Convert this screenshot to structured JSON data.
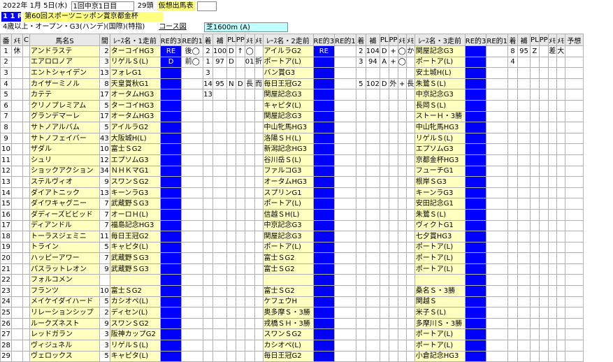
{
  "header": {
    "date": "2022年 1月 5日(水)",
    "meet": "1回中京1日目",
    "heads": "29頭",
    "status": "仮想出馬表",
    "race_no": "1 1 R",
    "race_name": "第60回スポーツニッポン賞京都金杯",
    "conditions": "4歳以上・オープン・G3(ハンデ)(国際)(特指)",
    "course_label": "コース図",
    "course": "芝1600m (A)"
  },
  "columns": [
    "番",
    "ﾒﾓ",
    "C",
    "馬名S",
    "間",
    "ﾚｰｽ名・1走前",
    "RE的3",
    "RE的1",
    "着",
    "補",
    "PL",
    "PP",
    "ﾒﾓ",
    "ﾒﾓ",
    "ﾚｰｽ名・2走前",
    "RE的3",
    "RE的1",
    "着",
    "補",
    "PL",
    "PP",
    "ﾒﾓ",
    "ﾒﾓ",
    "ﾚｰｽ名・3走前",
    "RE的3",
    "RE的1",
    "着",
    "補",
    "PL",
    "PP",
    "ﾒﾓ",
    "ﾒﾓ",
    "予想"
  ],
  "rows": [
    {
      "no": "1",
      "memo": "休",
      "c": "",
      "name": "アンドラステ",
      "gap": "2",
      "r1": "ターコイHG3",
      "r1a": "RE",
      "r1b": "後◯",
      "r1p": "2",
      "r1h": "100",
      "r1pl": "D",
      "r1pp": "↑",
      "r1m": "◯",
      "r1m2": "",
      "r2": "アイルラG2",
      "r2a": "RE",
      "r2b": "",
      "r2p": "2",
      "r2h": "104",
      "r2pl": "D",
      "r2pp": "+",
      "r2m": "◯",
      "r2m2": "か",
      "r3": "関屋記念G3",
      "r3a": "",
      "r3b": "",
      "r3p": "8",
      "r3h": "95",
      "r3pl": "Z",
      "r3pp": "",
      "r3m": "差",
      "r3m2": "大"
    },
    {
      "no": "2",
      "memo": "",
      "c": "",
      "name": "エアロロノア",
      "gap": "3",
      "r1": "リゲルＳ(L)",
      "r1a": "D",
      "r1b": "前◯",
      "r1p": "1",
      "r1h": "97",
      "r1pl": "D",
      "r1pp": "",
      "r1m": "01",
      "r1m2": "折",
      "r2": "ポートア(L)",
      "r2a": "",
      "r2b": "",
      "r2p": "3",
      "r2h": "94",
      "r2pl": "A",
      "r2pp": "+",
      "r2m": "◯",
      "r2m2": "",
      "r3": "ポートア(L)",
      "r3a": "",
      "r3b": "",
      "r3p": "4",
      "r3h": "",
      "r3pl": "",
      "r3pp": "",
      "r3m": "",
      "r3m2": ""
    },
    {
      "no": "3",
      "memo": "",
      "c": "",
      "name": "エントシャイデン",
      "gap": "13",
      "r1": "フォレG1",
      "r1a": "",
      "r1b": "",
      "r1p": "3",
      "r1h": "",
      "r1pl": "",
      "r1pp": "",
      "r1m": "",
      "r1m2": "",
      "r2": "バン賞G3",
      "r2a": "",
      "r2b": "",
      "r2p": "",
      "r2h": "",
      "r2pl": "",
      "r2pp": "",
      "r2m": "",
      "r2m2": "",
      "r3": "安土城H(L)",
      "r3a": "",
      "r3b": "",
      "r3p": "",
      "r3h": "",
      "r3pl": "",
      "r3pp": "",
      "r3m": "",
      "r3m2": ""
    },
    {
      "no": "4",
      "memo": "",
      "c": "",
      "name": "カイザーミノル",
      "gap": "8",
      "r1": "天皇賞秋G1",
      "r1a": "",
      "r1b": "",
      "r1p": "14",
      "r1h": "95",
      "r1pl": "N",
      "r1pp": "D",
      "r1m": "長",
      "r1m2": "而",
      "r2": "毎日王冠G2",
      "r2a": "",
      "r2b": "",
      "r2p": "5",
      "r2h": "102",
      "r2pl": "D",
      "r2pp": "外",
      "r2m": "+",
      "r2m2": "長",
      "r3": "朱鷺Ｓ(L)",
      "r3a": "",
      "r3b": "",
      "r3p": "",
      "r3h": "",
      "r3pl": "",
      "r3pp": "",
      "r3m": "",
      "r3m2": ""
    },
    {
      "no": "5",
      "memo": "",
      "c": "",
      "name": "カテテ",
      "gap": "17",
      "r1": "オータムHG3",
      "r1a": "",
      "r1b": "",
      "r1p": "13",
      "r1h": "",
      "r1pl": "",
      "r1pp": "",
      "r1m": "",
      "r1m2": "",
      "r2": "関屋記念G3",
      "r2a": "",
      "r2b": "",
      "r2p": "",
      "r2h": "",
      "r2pl": "",
      "r2pp": "",
      "r2m": "",
      "r2m2": "",
      "r3": "中京記念G3",
      "r3a": "",
      "r3b": "",
      "r3p": "",
      "r3h": "",
      "r3pl": "",
      "r3pp": "",
      "r3m": "",
      "r3m2": ""
    },
    {
      "no": "6",
      "memo": "",
      "c": "",
      "name": "クリノプレミアム",
      "gap": "5",
      "r1": "ターコイHG3",
      "r1a": "",
      "r1b": "",
      "r1p": "",
      "r1h": "",
      "r1pl": "",
      "r1pp": "",
      "r1m": "",
      "r1m2": "",
      "r2": "キャピタ(L)",
      "r2a": "",
      "r2b": "",
      "r2p": "",
      "r2h": "",
      "r2pl": "",
      "r2pp": "",
      "r2m": "",
      "r2m2": "",
      "r3": "長岡Ｓ(L)",
      "r3a": "",
      "r3b": "",
      "r3p": "",
      "r3h": "",
      "r3pl": "",
      "r3pp": "",
      "r3m": "",
      "r3m2": ""
    },
    {
      "no": "7",
      "memo": "",
      "c": "",
      "name": "グランデマーレ",
      "gap": "17",
      "r1": "オータムHG3",
      "r1a": "",
      "r1b": "",
      "r1p": "",
      "r1h": "",
      "r1pl": "",
      "r1pp": "",
      "r1m": "",
      "r1m2": "",
      "r2": "関屋記念G3",
      "r2a": "",
      "r2b": "",
      "r2p": "",
      "r2h": "",
      "r2pl": "",
      "r2pp": "",
      "r2m": "",
      "r2m2": "",
      "r3": "ストーＨ・3勝",
      "r3a": "",
      "r3b": "",
      "r3p": "",
      "r3h": "",
      "r3pl": "",
      "r3pp": "",
      "r3m": "",
      "r3m2": ""
    },
    {
      "no": "8",
      "memo": "",
      "c": "",
      "name": "サトノアルバム",
      "gap": "5",
      "r1": "アイルラG2",
      "r1a": "",
      "r1b": "",
      "r1p": "",
      "r1h": "",
      "r1pl": "",
      "r1pp": "",
      "r1m": "",
      "r1m2": "",
      "r2": "中山牝馬HG3",
      "r2a": "",
      "r2b": "",
      "r2p": "",
      "r2h": "",
      "r2pl": "",
      "r2pp": "",
      "r2m": "",
      "r2m2": "",
      "r3": "中山牝馬HG3",
      "r3a": "",
      "r3b": "",
      "r3p": "",
      "r3h": "",
      "r3pl": "",
      "r3pp": "",
      "r3m": "",
      "r3m2": ""
    },
    {
      "no": "9",
      "memo": "",
      "c": "",
      "name": "サトノフェイバー",
      "gap": "43",
      "r1": "大阪城H(L)",
      "r1a": "",
      "r1b": "",
      "r1p": "",
      "r1h": "",
      "r1pl": "",
      "r1pp": "",
      "r1m": "",
      "r1m2": "",
      "r2": "洛陽ＳＨ(L)",
      "r2a": "",
      "r2b": "",
      "r2p": "",
      "r2h": "",
      "r2pl": "",
      "r2pp": "",
      "r2m": "",
      "r2m2": "",
      "r3": "リゲルＳ(L)",
      "r3a": "",
      "r3b": "",
      "r3p": "",
      "r3h": "",
      "r3pl": "",
      "r3pp": "",
      "r3m": "",
      "r3m2": ""
    },
    {
      "no": "10",
      "memo": "",
      "c": "",
      "name": "ザダル",
      "gap": "10",
      "r1": "富士ＳG2",
      "r1a": "",
      "r1b": "",
      "r1p": "",
      "r1h": "",
      "r1pl": "",
      "r1pp": "",
      "r1m": "",
      "r1m2": "",
      "r2": "新潟記念HG3",
      "r2a": "",
      "r2b": "",
      "r2p": "",
      "r2h": "",
      "r2pl": "",
      "r2pp": "",
      "r2m": "",
      "r2m2": "",
      "r3": "エプソムG3",
      "r3a": "",
      "r3b": "",
      "r3p": "",
      "r3h": "",
      "r3pl": "",
      "r3pp": "",
      "r3m": "",
      "r3m2": ""
    },
    {
      "no": "11",
      "memo": "",
      "c": "",
      "name": "シュリ",
      "gap": "12",
      "r1": "エプソムG3",
      "r1a": "",
      "r1b": "",
      "r1p": "",
      "r1h": "",
      "r1pl": "",
      "r1pp": "",
      "r1m": "",
      "r1m2": "",
      "r2": "谷川岳Ｓ(L)",
      "r2a": "",
      "r2b": "",
      "r2p": "",
      "r2h": "",
      "r2pl": "",
      "r2pp": "",
      "r2m": "",
      "r2m2": "",
      "r3": "京都金杯HG3",
      "r3a": "",
      "r3b": "",
      "r3p": "",
      "r3h": "",
      "r3pl": "",
      "r3pp": "",
      "r3m": "",
      "r3m2": ""
    },
    {
      "no": "12",
      "memo": "",
      "c": "",
      "name": "ショックアクション",
      "gap": "34",
      "r1": "ＮＨＫマG1",
      "r1a": "",
      "r1b": "",
      "r1p": "",
      "r1h": "",
      "r1pl": "",
      "r1pp": "",
      "r1m": "",
      "r1m2": "",
      "r2": "ファルコG3",
      "r2a": "",
      "r2b": "",
      "r2p": "",
      "r2h": "",
      "r2pl": "",
      "r2pp": "",
      "r2m": "",
      "r2m2": "",
      "r3": "フューチG1",
      "r3a": "",
      "r3b": "",
      "r3p": "",
      "r3h": "",
      "r3pl": "",
      "r3pp": "",
      "r3m": "",
      "r3m2": ""
    },
    {
      "no": "13",
      "memo": "",
      "c": "",
      "name": "ステルヴィオ",
      "gap": "9",
      "r1": "スワンＳG2",
      "r1a": "",
      "r1b": "",
      "r1p": "",
      "r1h": "",
      "r1pl": "",
      "r1pp": "",
      "r1m": "",
      "r1m2": "",
      "r2": "オータムHG3",
      "r2a": "",
      "r2b": "",
      "r2p": "",
      "r2h": "",
      "r2pl": "",
      "r2pp": "",
      "r2m": "",
      "r2m2": "",
      "r3": "根岸ＳG3",
      "r3a": "",
      "r3b": "",
      "r3p": "",
      "r3h": "",
      "r3pl": "",
      "r3pp": "",
      "r3m": "",
      "r3m2": ""
    },
    {
      "no": "14",
      "memo": "",
      "c": "",
      "name": "ダイアトニック",
      "gap": "13",
      "r1": "キーンラG3",
      "r1a": "",
      "r1b": "",
      "r1p": "",
      "r1h": "",
      "r1pl": "",
      "r1pp": "",
      "r1m": "",
      "r1m2": "",
      "r2": "スプリンG1",
      "r2a": "",
      "r2b": "",
      "r2p": "",
      "r2h": "",
      "r2pl": "",
      "r2pp": "",
      "r2m": "",
      "r2m2": "",
      "r3": "キーンラG3",
      "r3a": "",
      "r3b": "",
      "r3p": "",
      "r3h": "",
      "r3pl": "",
      "r3pp": "",
      "r3m": "",
      "r3m2": ""
    },
    {
      "no": "15",
      "memo": "",
      "c": "",
      "name": "ダイワキャグニー",
      "gap": "7",
      "r1": "武蔵野ＳG3",
      "r1a": "",
      "r1b": "",
      "r1p": "",
      "r1h": "",
      "r1pl": "",
      "r1pp": "",
      "r1m": "",
      "r1m2": "",
      "r2": "ポートア(L)",
      "r2a": "",
      "r2b": "",
      "r2p": "",
      "r2h": "",
      "r2pl": "",
      "r2pp": "",
      "r2m": "",
      "r2m2": "",
      "r3": "安田記念G1",
      "r3a": "",
      "r3b": "",
      "r3p": "",
      "r3h": "",
      "r3pl": "",
      "r3pp": "",
      "r3m": "",
      "r3m2": ""
    },
    {
      "no": "16",
      "memo": "",
      "c": "",
      "name": "ダディーズビビッド",
      "gap": "7",
      "r1": "オーロＨ(L)",
      "r1a": "",
      "r1b": "",
      "r1p": "",
      "r1h": "",
      "r1pl": "",
      "r1pp": "",
      "r1m": "",
      "r1m2": "",
      "r2": "信越ＳH(L)",
      "r2a": "",
      "r2b": "",
      "r2p": "",
      "r2h": "",
      "r2pl": "",
      "r2pp": "",
      "r2m": "",
      "r2m2": "",
      "r3": "朱鷺Ｓ(L)",
      "r3a": "",
      "r3b": "",
      "r3p": "",
      "r3h": "",
      "r3pl": "",
      "r3pp": "",
      "r3m": "",
      "r3m2": ""
    },
    {
      "no": "17",
      "memo": "",
      "c": "",
      "name": "ディアンドル",
      "gap": "7",
      "r1": "福島記念HG3",
      "r1a": "",
      "r1b": "",
      "r1p": "",
      "r1h": "",
      "r1pl": "",
      "r1pp": "",
      "r1m": "",
      "r1m2": "",
      "r2": "中京記念G3",
      "r2a": "",
      "r2b": "",
      "r2p": "",
      "r2h": "",
      "r2pl": "",
      "r2pp": "",
      "r2m": "",
      "r2m2": "",
      "r3": "ヴィクトG1",
      "r3a": "",
      "r3b": "",
      "r3p": "",
      "r3h": "",
      "r3pl": "",
      "r3pp": "",
      "r3m": "",
      "r3m2": ""
    },
    {
      "no": "18",
      "memo": "",
      "c": "",
      "name": "トーラスジェミニ",
      "gap": "11",
      "r1": "毎日王冠G2",
      "r1a": "",
      "r1b": "",
      "r1p": "",
      "r1h": "",
      "r1pl": "",
      "r1pp": "",
      "r1m": "",
      "r1m2": "",
      "r2": "関屋記念G3",
      "r2a": "",
      "r2b": "",
      "r2p": "",
      "r2h": "",
      "r2pl": "",
      "r2pp": "",
      "r2m": "",
      "r2m2": "",
      "r3": "七夕賞HG3",
      "r3a": "",
      "r3b": "",
      "r3p": "",
      "r3h": "",
      "r3pl": "",
      "r3pp": "",
      "r3m": "",
      "r3m2": ""
    },
    {
      "no": "19",
      "memo": "",
      "c": "",
      "name": "トライン",
      "gap": "5",
      "r1": "キャピタ(L)",
      "r1a": "",
      "r1b": "",
      "r1p": "",
      "r1h": "",
      "r1pl": "",
      "r1pp": "",
      "r1m": "",
      "r1m2": "",
      "r2": "ポートア(L)",
      "r2a": "",
      "r2b": "",
      "r2p": "",
      "r2h": "",
      "r2pl": "",
      "r2pp": "",
      "r2m": "",
      "r2m2": "",
      "r3": "ポートア(L)",
      "r3a": "",
      "r3b": "",
      "r3p": "",
      "r3h": "",
      "r3pl": "",
      "r3pp": "",
      "r3m": "",
      "r3m2": ""
    },
    {
      "no": "20",
      "memo": "",
      "c": "",
      "name": "ハッピーアワー",
      "gap": "7",
      "r1": "武蔵野ＳG3",
      "r1a": "",
      "r1b": "",
      "r1p": "",
      "r1h": "",
      "r1pl": "",
      "r1pp": "",
      "r1m": "",
      "r1m2": "",
      "r2": "富士ＳG2",
      "r2a": "",
      "r2b": "",
      "r2p": "",
      "r2h": "",
      "r2pl": "",
      "r2pp": "",
      "r2m": "",
      "r2m2": "",
      "r3": "ポートア(L)",
      "r3a": "",
      "r3b": "",
      "r3p": "",
      "r3h": "",
      "r3pl": "",
      "r3pp": "",
      "r3m": "",
      "r3m2": ""
    },
    {
      "no": "21",
      "memo": "",
      "c": "",
      "name": "パスラットレオン",
      "gap": "9",
      "r1": "武蔵野ＳG3",
      "r1a": "",
      "r1b": "",
      "r1p": "",
      "r1h": "",
      "r1pl": "",
      "r1pp": "",
      "r1m": "",
      "r1m2": "",
      "r2": "富士ＳG2",
      "r2a": "",
      "r2b": "",
      "r2p": "",
      "r2h": "",
      "r2pl": "",
      "r2pp": "",
      "r2m": "",
      "r2m2": "",
      "r3": "ポートア(L)",
      "r3a": "",
      "r3b": "",
      "r3p": "",
      "r3h": "",
      "r3pl": "",
      "r3pp": "",
      "r3m": "",
      "r3m2": ""
    },
    {
      "no": "22",
      "memo": "",
      "c": "",
      "name": "フォルコメン",
      "gap": "",
      "r1": "",
      "r1a": "",
      "r1b": "",
      "r1p": "",
      "r1h": "",
      "r1pl": "",
      "r1pp": "",
      "r1m": "",
      "r1m2": "",
      "r2": "",
      "r2a": "",
      "r2b": "",
      "r2p": "",
      "r2h": "",
      "r2pl": "",
      "r2pp": "",
      "r2m": "",
      "r2m2": "",
      "r3": "",
      "r3a": "",
      "r3b": "",
      "r3p": "",
      "r3h": "",
      "r3pl": "",
      "r3pp": "",
      "r3m": "",
      "r3m2": ""
    },
    {
      "no": "23",
      "memo": "",
      "c": "",
      "name": "フランツ",
      "gap": "10",
      "r1": "富士ＳG2",
      "r1a": "",
      "r1b": "",
      "r1p": "",
      "r1h": "",
      "r1pl": "",
      "r1pp": "",
      "r1m": "",
      "r1m2": "",
      "r2": "富士ＳG2",
      "r2a": "",
      "r2b": "",
      "r2p": "",
      "r2h": "",
      "r2pl": "",
      "r2pp": "",
      "r2m": "",
      "r2m2": "",
      "r3": "桑名Ｓ・3勝",
      "r3a": "",
      "r3b": "",
      "r3p": "",
      "r3h": "",
      "r3pl": "",
      "r3pp": "",
      "r3m": "",
      "r3m2": ""
    },
    {
      "no": "24",
      "memo": "",
      "c": "",
      "name": "メイケイダイハード",
      "gap": "5",
      "r1": "カシオペ(L)",
      "r1a": "",
      "r1b": "",
      "r1p": "",
      "r1h": "",
      "r1pl": "",
      "r1pp": "",
      "r1m": "",
      "r1m2": "",
      "r2": "ケフェウH",
      "r2a": "",
      "r2b": "",
      "r2p": "",
      "r2h": "",
      "r2pl": "",
      "r2pp": "",
      "r2m": "",
      "r2m2": "",
      "r3": "関越Ｓ",
      "r3a": "",
      "r3b": "",
      "r3p": "",
      "r3h": "",
      "r3pl": "",
      "r3pp": "",
      "r3m": "",
      "r3m2": ""
    },
    {
      "no": "25",
      "memo": "",
      "c": "",
      "name": "リレーションシップ",
      "gap": "2",
      "r1": "ディセン(L)",
      "r1a": "",
      "r1b": "",
      "r1p": "",
      "r1h": "",
      "r1pl": "",
      "r1pp": "",
      "r1m": "",
      "r1m2": "",
      "r2": "奥多摩Ｓ・3勝",
      "r2a": "",
      "r2b": "",
      "r2p": "",
      "r2h": "",
      "r2pl": "",
      "r2pp": "",
      "r2m": "",
      "r2m2": "",
      "r3": "米子Ｓ(L)",
      "r3a": "",
      "r3b": "",
      "r3p": "",
      "r3h": "",
      "r3pl": "",
      "r3pp": "",
      "r3m": "",
      "r3m2": ""
    },
    {
      "no": "26",
      "memo": "",
      "c": "",
      "name": "ルークズネスト",
      "gap": "9",
      "r1": "スワンＳG2",
      "r1a": "",
      "r1b": "",
      "r1p": "",
      "r1h": "",
      "r1pl": "",
      "r1pp": "",
      "r1m": "",
      "r1m2": "",
      "r2": "戎橋ＳＨ・3勝",
      "r2a": "",
      "r2b": "",
      "r2p": "",
      "r2h": "",
      "r2pl": "",
      "r2pp": "",
      "r2m": "",
      "r2m2": "",
      "r3": "多摩川Ｓ・3勝",
      "r3a": "",
      "r3b": "",
      "r3p": "",
      "r3h": "",
      "r3pl": "",
      "r3pp": "",
      "r3m": "",
      "r3m2": ""
    },
    {
      "no": "27",
      "memo": "",
      "c": "",
      "name": "レッドガラン",
      "gap": "3",
      "r1": "阪神カップG2",
      "r1a": "",
      "r1b": "",
      "r1p": "",
      "r1h": "",
      "r1pl": "",
      "r1pp": "",
      "r1m": "",
      "r1m2": "",
      "r2": "スワンＳG2",
      "r2a": "",
      "r2b": "",
      "r2p": "",
      "r2h": "",
      "r2pl": "",
      "r2pp": "",
      "r2m": "",
      "r2m2": "",
      "r3": "ポートア(L)",
      "r3a": "",
      "r3b": "",
      "r3p": "",
      "r3h": "",
      "r3pl": "",
      "r3pp": "",
      "r3m": "",
      "r3m2": ""
    },
    {
      "no": "28",
      "memo": "",
      "c": "",
      "name": "ヴィジュネル",
      "gap": "3",
      "r1": "リゲルＳ(L)",
      "r1a": "",
      "r1b": "",
      "r1p": "",
      "r1h": "",
      "r1pl": "",
      "r1pp": "",
      "r1m": "",
      "r1m2": "",
      "r2": "カシオペ(L)",
      "r2a": "",
      "r2b": "",
      "r2p": "",
      "r2h": "",
      "r2pl": "",
      "r2pp": "",
      "r2m": "",
      "r2m2": "",
      "r3": "ポートア(L)",
      "r3a": "",
      "r3b": "",
      "r3p": "",
      "r3h": "",
      "r3pl": "",
      "r3pp": "",
      "r3m": "",
      "r3m2": ""
    },
    {
      "no": "29",
      "memo": "",
      "c": "",
      "name": "ヴェロックス",
      "gap": "5",
      "r1": "キャピタ(L)",
      "r1a": "",
      "r1b": "",
      "r1p": "",
      "r1h": "",
      "r1pl": "",
      "r1pp": "",
      "r1m": "",
      "r1m2": "",
      "r2": "毎日王冠G2",
      "r2a": "",
      "r2b": "",
      "r2p": "",
      "r2h": "",
      "r2pl": "",
      "r2pp": "",
      "r2m": "",
      "r2m2": "",
      "r3": "小倉記念HG3",
      "r3a": "",
      "r3b": "",
      "r3p": "",
      "r3h": "",
      "r3pl": "",
      "r3pp": "",
      "r3m": "",
      "r3m2": ""
    }
  ]
}
